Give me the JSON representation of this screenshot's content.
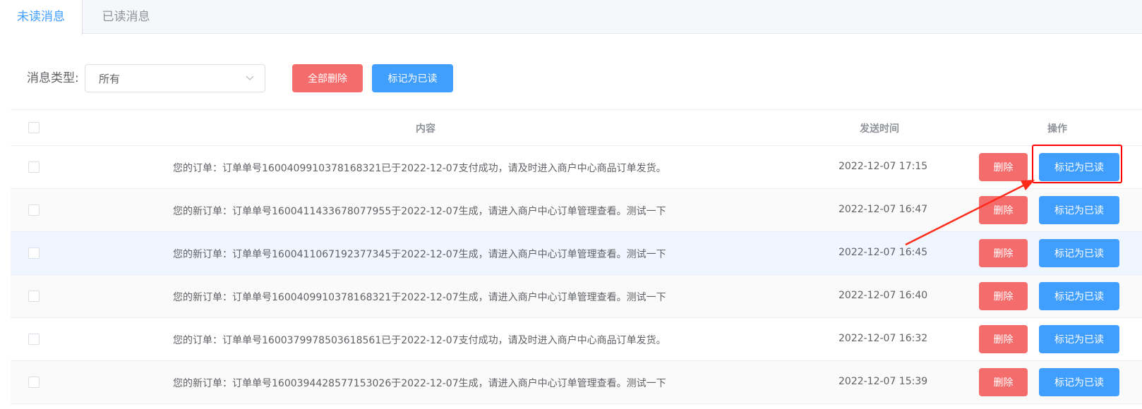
{
  "tabs": [
    {
      "label": "未读消息",
      "active": true
    },
    {
      "label": "已读消息",
      "active": false
    }
  ],
  "filter": {
    "label": "消息类型:",
    "selected": "所有"
  },
  "toolbar": {
    "delete_all_label": "全部删除",
    "mark_all_read_label": "标记为已读"
  },
  "table": {
    "columns": {
      "content": "内容",
      "time": "发送时间",
      "action": "操作"
    },
    "delete_label": "删除",
    "mark_read_label": "标记为已读",
    "rows": [
      {
        "content": "您的订单：订单单号1600409910378168321已于2022-12-07支付成功，请及时进入商户中心商品订单发货。",
        "time": "2022-12-07 17:15"
      },
      {
        "content": "您的新订单：订单单号1600411433678077955于2022-12-07生成，请进入商户中心订单管理查看。测试一下",
        "time": "2022-12-07 16:47"
      },
      {
        "content": "您的新订单：订单单号1600411067192377345于2022-12-07生成，请进入商户中心订单管理查看。测试一下",
        "time": "2022-12-07 16:45"
      },
      {
        "content": "您的新订单：订单单号1600409910378168321于2022-12-07生成，请进入商户中心订单管理查看。测试一下",
        "time": "2022-12-07 16:40"
      },
      {
        "content": "您的订单：订单单号1600379978503618561已于2022-12-07支付成功，请及时进入商户中心商品订单发货。",
        "time": "2022-12-07 16:32"
      },
      {
        "content": "您的新订单：订单单号1600394428577153026于2022-12-07生成，请进入商户中心订单管理查看。测试一下",
        "time": "2022-12-07 15:39"
      }
    ]
  },
  "colors": {
    "primary": "#409eff",
    "danger": "#f56c6c",
    "annotation": "#ff0000"
  }
}
